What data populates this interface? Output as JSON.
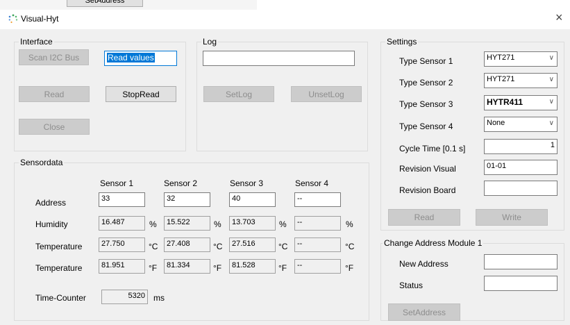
{
  "background_fragment": {
    "label": "SetAddress"
  },
  "window": {
    "title": "Visual-Hyt",
    "close": "×"
  },
  "interface": {
    "title": "Interface",
    "scan_i2c": "Scan I2C Bus",
    "read_values": "Read values",
    "read": "Read",
    "stop_read": "StopRead",
    "close": "Close"
  },
  "log": {
    "title": "Log",
    "value": "",
    "set_log": "SetLog",
    "unset_log": "UnsetLog"
  },
  "sensordata": {
    "title": "Sensordata",
    "columns": [
      "Sensor 1",
      "Sensor 2",
      "Sensor 3",
      "Sensor 4"
    ],
    "rows": [
      {
        "label": "Address",
        "unit": "",
        "values": [
          "33",
          "32",
          "40",
          "--"
        ]
      },
      {
        "label": "Humidity",
        "unit": "%",
        "values": [
          "16.487",
          "15.522",
          "13.703",
          "--"
        ]
      },
      {
        "label": "Temperature",
        "unit": "°C",
        "values": [
          "27.750",
          "27.408",
          "27.516",
          "--"
        ]
      },
      {
        "label": "Temperature",
        "unit": "°F",
        "values": [
          "81.951",
          "81.334",
          "81.528",
          "--"
        ]
      }
    ],
    "time_counter_label": "Time-Counter",
    "time_counter_value": "5320",
    "time_counter_unit": "ms"
  },
  "settings": {
    "title": "Settings",
    "type_sensor_1_label": "Type Sensor 1",
    "type_sensor_1": "HYT271",
    "type_sensor_2_label": "Type Sensor 2",
    "type_sensor_2": "HYT271",
    "type_sensor_3_label": "Type Sensor 3",
    "type_sensor_3": "HYTR411",
    "type_sensor_4_label": "Type Sensor 4",
    "type_sensor_4": "None",
    "cycle_time_label": "Cycle Time [0.1 s]",
    "cycle_time": "1",
    "revision_visual_label": "Revision Visual",
    "revision_visual": "01-01",
    "revision_board_label": "Revision Board",
    "revision_board": "",
    "read": "Read",
    "write": "Write"
  },
  "change_address": {
    "title": "Change Address Module 1",
    "new_address_label": "New Address",
    "new_address": "",
    "status_label": "Status",
    "status": "",
    "set_address": "SetAddress"
  }
}
